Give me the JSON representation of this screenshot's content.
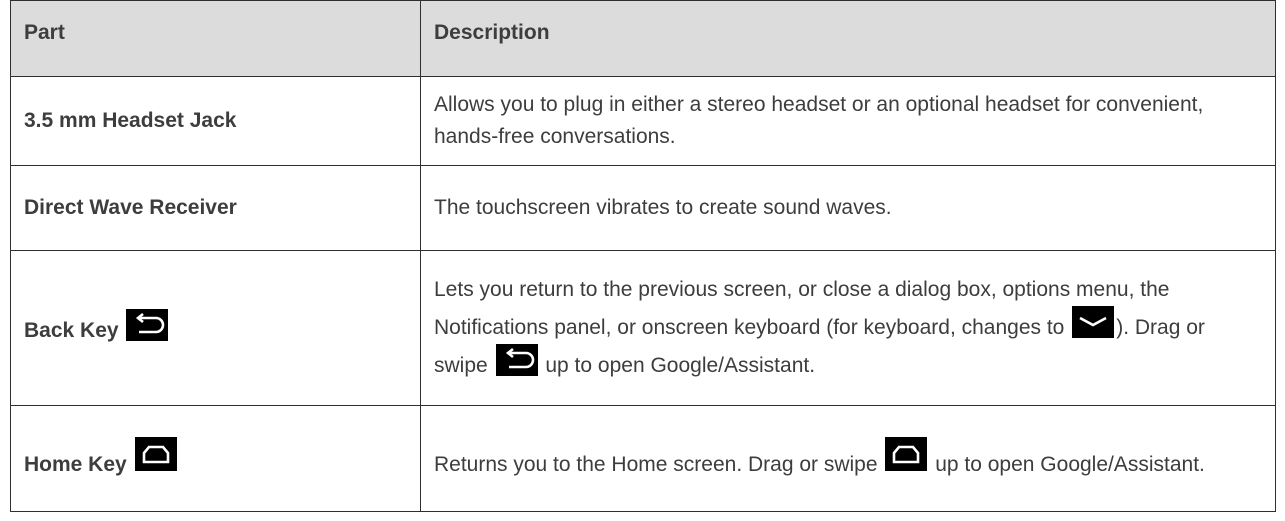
{
  "table": {
    "headers": {
      "part": "Part",
      "description": "Description"
    },
    "rows": [
      {
        "part": "3.5 mm Headset Jack",
        "description": "Allows you to plug in either a stereo headset or an optional headset for convenient, hands-free conversations."
      },
      {
        "part": "Direct Wave Receiver",
        "description": "The touchscreen vibrates to create sound waves."
      },
      {
        "part": "Back Key",
        "part_icon": "back-arrow-icon",
        "description_parts": [
          "Lets you return to the previous screen, or close a dialog box, options menu, the Notifications panel, or onscreen keyboard (for keyboard, changes to ",
          "). Drag or swipe ",
          " up to open Google/Assistant."
        ],
        "description_icons": [
          "chevron-down-icon",
          "back-arrow-icon"
        ]
      },
      {
        "part": "Home Key",
        "part_icon": "home-icon",
        "description_parts": [
          "Returns you to the Home screen. Drag or swipe ",
          " up to open Google/Assistant."
        ],
        "description_icons": [
          "home-icon"
        ]
      }
    ]
  },
  "colors": {
    "header_bg": "#dcdcdc",
    "border": "#2f2f2f",
    "text": "#3d3d3d",
    "icon_bg": "#000000"
  }
}
